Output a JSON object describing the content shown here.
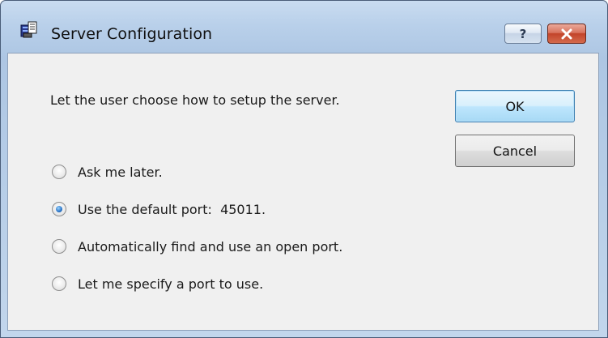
{
  "window": {
    "title": "Server Configuration",
    "help_label": "?"
  },
  "dialog": {
    "message": "Let the user choose how to setup the server.",
    "ok_label": "OK",
    "cancel_label": "Cancel",
    "options": [
      {
        "label": "Ask me later.",
        "checked": false
      },
      {
        "label": "Use the default port:  45011.",
        "checked": true
      },
      {
        "label": "Automatically find and use an open port.",
        "checked": false
      },
      {
        "label": "Let me specify a port to use.",
        "checked": false
      }
    ]
  },
  "colors": {
    "frame": "#b9d0ea",
    "client": "#f0f0f0",
    "close": "#c2442a",
    "ok_border": "#3c7fb1"
  }
}
